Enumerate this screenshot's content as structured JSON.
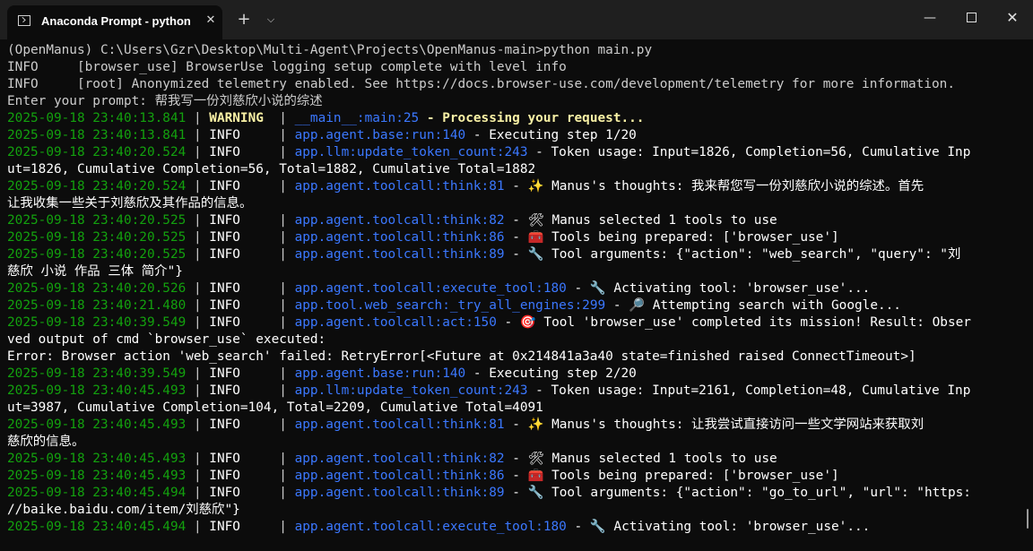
{
  "window": {
    "tab_title": "Anaconda Prompt - python m",
    "tab_close": "✕",
    "new_tab": "+",
    "dropdown": "⌵",
    "minimize": "—",
    "close": "✕"
  },
  "colors": {
    "background": "#0c0c0c",
    "default": "#cccccc",
    "timestamp": "#13a10e",
    "module": "#3b78ff",
    "warning": "#f9f1a5",
    "message": "#ffffff"
  },
  "lines": [
    [
      {
        "t": "(OpenManus) C:\\Users\\Gzr\\Desktop\\Multi-Agent\\Projects\\OpenManus-main>python main.py",
        "c": "default"
      }
    ],
    [
      {
        "t": "INFO     [browser_use] BrowserUse logging setup complete with level info",
        "c": "default"
      }
    ],
    [
      {
        "t": "INFO     [root] Anonymized telemetry enabled. See https://docs.browser-use.com/development/telemetry for more information.",
        "c": "default"
      }
    ],
    [
      {
        "t": "Enter your prompt: 帮我写一份刘慈欣小说的综述",
        "c": "default"
      }
    ],
    [
      {
        "t": "2025-09-18 23:40:13.841",
        "c": "timestamp"
      },
      {
        "t": " | ",
        "c": "default"
      },
      {
        "t": "WARNING ",
        "c": "warning"
      },
      {
        "t": " | ",
        "c": "default"
      },
      {
        "t": "__main__:main:25",
        "c": "module"
      },
      {
        "t": " - Processing your request...",
        "c": "warning"
      }
    ],
    [
      {
        "t": "2025-09-18 23:40:13.841",
        "c": "timestamp"
      },
      {
        "t": " | ",
        "c": "default"
      },
      {
        "t": "INFO    ",
        "c": "message"
      },
      {
        "t": " | ",
        "c": "default"
      },
      {
        "t": "app.agent.base:run:140",
        "c": "module"
      },
      {
        "t": " - Executing step 1/20",
        "c": "message"
      }
    ],
    [
      {
        "t": "2025-09-18 23:40:20.524",
        "c": "timestamp"
      },
      {
        "t": " | ",
        "c": "default"
      },
      {
        "t": "INFO    ",
        "c": "message"
      },
      {
        "t": " | ",
        "c": "default"
      },
      {
        "t": "app.llm:update_token_count:243",
        "c": "module"
      },
      {
        "t": " - Token usage: Input=1826, Completion=56, Cumulative Inp",
        "c": "message"
      }
    ],
    [
      {
        "t": "ut=1826, Cumulative Completion=56, Total=1882, Cumulative Total=1882",
        "c": "message"
      }
    ],
    [
      {
        "t": "2025-09-18 23:40:20.524",
        "c": "timestamp"
      },
      {
        "t": " | ",
        "c": "default"
      },
      {
        "t": "INFO    ",
        "c": "message"
      },
      {
        "t": " | ",
        "c": "default"
      },
      {
        "t": "app.agent.toolcall:think:81",
        "c": "module"
      },
      {
        "t": " - ✨ Manus's thoughts: 我来帮您写一份刘慈欣小说的综述。首先",
        "c": "message"
      }
    ],
    [
      {
        "t": "让我收集一些关于刘慈欣及其作品的信息。",
        "c": "message"
      }
    ],
    [
      {
        "t": "2025-09-18 23:40:20.525",
        "c": "timestamp"
      },
      {
        "t": " | ",
        "c": "default"
      },
      {
        "t": "INFO    ",
        "c": "message"
      },
      {
        "t": " | ",
        "c": "default"
      },
      {
        "t": "app.agent.toolcall:think:82",
        "c": "module"
      },
      {
        "t": " - 🛠 Manus selected 1 tools to use",
        "c": "message"
      }
    ],
    [
      {
        "t": "2025-09-18 23:40:20.525",
        "c": "timestamp"
      },
      {
        "t": " | ",
        "c": "default"
      },
      {
        "t": "INFO    ",
        "c": "message"
      },
      {
        "t": " | ",
        "c": "default"
      },
      {
        "t": "app.agent.toolcall:think:86",
        "c": "module"
      },
      {
        "t": " - 🧰 Tools being prepared: ['browser_use']",
        "c": "message"
      }
    ],
    [
      {
        "t": "2025-09-18 23:40:20.525",
        "c": "timestamp"
      },
      {
        "t": " | ",
        "c": "default"
      },
      {
        "t": "INFO    ",
        "c": "message"
      },
      {
        "t": " | ",
        "c": "default"
      },
      {
        "t": "app.agent.toolcall:think:89",
        "c": "module"
      },
      {
        "t": " - 🔧 Tool arguments: {\"action\": \"web_search\", \"query\": \"刘",
        "c": "message"
      }
    ],
    [
      {
        "t": "慈欣 小说 作品 三体 简介\"}",
        "c": "message"
      }
    ],
    [
      {
        "t": "2025-09-18 23:40:20.526",
        "c": "timestamp"
      },
      {
        "t": " | ",
        "c": "default"
      },
      {
        "t": "INFO    ",
        "c": "message"
      },
      {
        "t": " | ",
        "c": "default"
      },
      {
        "t": "app.agent.toolcall:execute_tool:180",
        "c": "module"
      },
      {
        "t": " - 🔧 Activating tool: 'browser_use'...",
        "c": "message"
      }
    ],
    [
      {
        "t": "2025-09-18 23:40:21.480",
        "c": "timestamp"
      },
      {
        "t": " | ",
        "c": "default"
      },
      {
        "t": "INFO    ",
        "c": "message"
      },
      {
        "t": " | ",
        "c": "default"
      },
      {
        "t": "app.tool.web_search:_try_all_engines:299",
        "c": "module"
      },
      {
        "t": " - 🔎 Attempting search with Google...",
        "c": "message"
      }
    ],
    [
      {
        "t": "2025-09-18 23:40:39.549",
        "c": "timestamp"
      },
      {
        "t": " | ",
        "c": "default"
      },
      {
        "t": "INFO    ",
        "c": "message"
      },
      {
        "t": " | ",
        "c": "default"
      },
      {
        "t": "app.agent.toolcall:act:150",
        "c": "module"
      },
      {
        "t": " - 🎯 Tool 'browser_use' completed its mission! Result: Obser",
        "c": "message"
      }
    ],
    [
      {
        "t": "ved output of cmd `browser_use` executed:",
        "c": "message"
      }
    ],
    [
      {
        "t": "Error: Browser action 'web_search' failed: RetryError[<Future at 0x214841a3a40 state=finished raised ConnectTimeout>]",
        "c": "message"
      }
    ],
    [
      {
        "t": "2025-09-18 23:40:39.549",
        "c": "timestamp"
      },
      {
        "t": " | ",
        "c": "default"
      },
      {
        "t": "INFO    ",
        "c": "message"
      },
      {
        "t": " | ",
        "c": "default"
      },
      {
        "t": "app.agent.base:run:140",
        "c": "module"
      },
      {
        "t": " - Executing step 2/20",
        "c": "message"
      }
    ],
    [
      {
        "t": "2025-09-18 23:40:45.493",
        "c": "timestamp"
      },
      {
        "t": " | ",
        "c": "default"
      },
      {
        "t": "INFO    ",
        "c": "message"
      },
      {
        "t": " | ",
        "c": "default"
      },
      {
        "t": "app.llm:update_token_count:243",
        "c": "module"
      },
      {
        "t": " - Token usage: Input=2161, Completion=48, Cumulative Inp",
        "c": "message"
      }
    ],
    [
      {
        "t": "ut=3987, Cumulative Completion=104, Total=2209, Cumulative Total=4091",
        "c": "message"
      }
    ],
    [
      {
        "t": "2025-09-18 23:40:45.493",
        "c": "timestamp"
      },
      {
        "t": " | ",
        "c": "default"
      },
      {
        "t": "INFO    ",
        "c": "message"
      },
      {
        "t": " | ",
        "c": "default"
      },
      {
        "t": "app.agent.toolcall:think:81",
        "c": "module"
      },
      {
        "t": " - ✨ Manus's thoughts: 让我尝试直接访问一些文学网站来获取刘",
        "c": "message"
      }
    ],
    [
      {
        "t": "慈欣的信息。",
        "c": "message"
      }
    ],
    [
      {
        "t": "2025-09-18 23:40:45.493",
        "c": "timestamp"
      },
      {
        "t": " | ",
        "c": "default"
      },
      {
        "t": "INFO    ",
        "c": "message"
      },
      {
        "t": " | ",
        "c": "default"
      },
      {
        "t": "app.agent.toolcall:think:82",
        "c": "module"
      },
      {
        "t": " - 🛠 Manus selected 1 tools to use",
        "c": "message"
      }
    ],
    [
      {
        "t": "2025-09-18 23:40:45.493",
        "c": "timestamp"
      },
      {
        "t": " | ",
        "c": "default"
      },
      {
        "t": "INFO    ",
        "c": "message"
      },
      {
        "t": " | ",
        "c": "default"
      },
      {
        "t": "app.agent.toolcall:think:86",
        "c": "module"
      },
      {
        "t": " - 🧰 Tools being prepared: ['browser_use']",
        "c": "message"
      }
    ],
    [
      {
        "t": "2025-09-18 23:40:45.494",
        "c": "timestamp"
      },
      {
        "t": " | ",
        "c": "default"
      },
      {
        "t": "INFO    ",
        "c": "message"
      },
      {
        "t": " | ",
        "c": "default"
      },
      {
        "t": "app.agent.toolcall:think:89",
        "c": "module"
      },
      {
        "t": " - 🔧 Tool arguments: {\"action\": \"go_to_url\", \"url\": \"https:",
        "c": "message"
      }
    ],
    [
      {
        "t": "//baike.baidu.com/item/刘慈欣\"}",
        "c": "message"
      }
    ],
    [
      {
        "t": "2025-09-18 23:40:45.494",
        "c": "timestamp"
      },
      {
        "t": " | ",
        "c": "default"
      },
      {
        "t": "INFO    ",
        "c": "message"
      },
      {
        "t": " | ",
        "c": "default"
      },
      {
        "t": "app.agent.toolcall:execute_tool:180",
        "c": "module"
      },
      {
        "t": " - 🔧 Activating tool: 'browser_use'...",
        "c": "message"
      }
    ]
  ]
}
